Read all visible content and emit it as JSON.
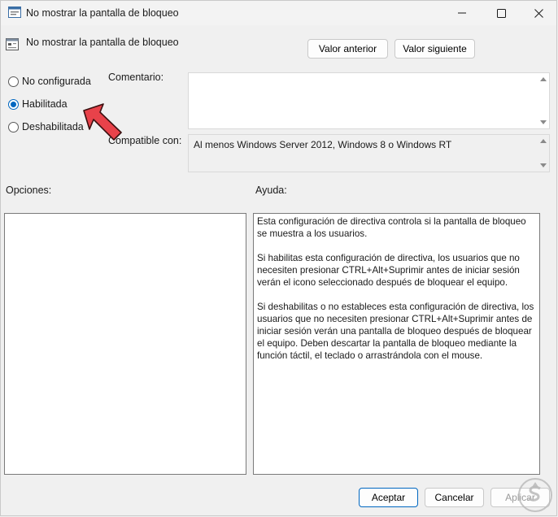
{
  "window": {
    "title": "No mostrar la pantalla de bloqueo",
    "policy_name": "No mostrar la pantalla de bloqueo"
  },
  "nav": {
    "prev_label": "Valor anterior",
    "next_label": "Valor siguiente"
  },
  "radios": [
    {
      "label": "No configurada",
      "checked": false
    },
    {
      "label": "Habilitada",
      "checked": true
    },
    {
      "label": "Deshabilitada",
      "checked": false
    }
  ],
  "comment": {
    "label": "Comentario:",
    "value": ""
  },
  "compat": {
    "label": "Compatible con:",
    "value": "Al menos Windows Server 2012, Windows 8 o Windows RT"
  },
  "options": {
    "label": "Opciones:"
  },
  "help": {
    "label": "Ayuda:",
    "paragraphs": [
      "Esta configuración de directiva controla si la pantalla de bloqueo se muestra a los usuarios.",
      "Si habilitas esta configuración de directiva, los usuarios que no necesiten presionar CTRL+Alt+Suprimir antes de iniciar sesión verán el icono seleccionado después de bloquear el equipo.",
      "Si deshabilitas o no estableces esta configuración de directiva, los usuarios que no necesiten presionar CTRL+Alt+Suprimir antes de iniciar sesión verán una pantalla de bloqueo después de bloquear el equipo. Deben descartar la pantalla de bloqueo mediante la función táctil, el teclado o arrastrándola con el mouse."
    ]
  },
  "footer": {
    "ok_label": "Aceptar",
    "cancel_label": "Cancelar",
    "apply_label": "Aplicar"
  },
  "colors": {
    "accent": "#0067c0",
    "pointer_red": "#e8424a"
  }
}
